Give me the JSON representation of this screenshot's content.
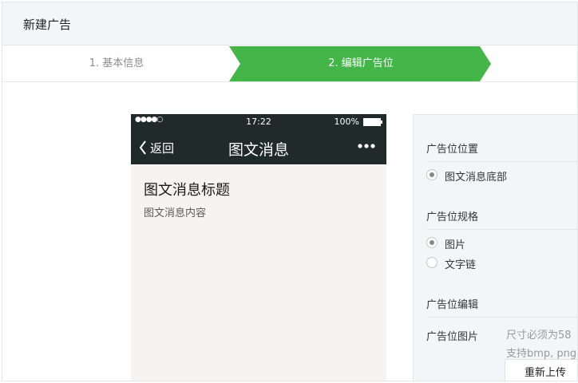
{
  "header": {
    "title": "新建广告"
  },
  "steps": [
    {
      "label": "1. 基本信息",
      "active": false
    },
    {
      "label": "2. 编辑广告位",
      "active": true
    }
  ],
  "colors": {
    "accent": "#44b549",
    "phone_dark": "#212a2b",
    "panel_bg": "#f4f5f9"
  },
  "phone": {
    "status": {
      "signal": "●●●●○",
      "time": "17:22",
      "battery": "100%"
    },
    "nav": {
      "back_label": "返回",
      "title": "图文消息",
      "more_icon": "more-dots-icon"
    },
    "article": {
      "title": "图文消息标题",
      "body": "图文消息内容"
    }
  },
  "panel": {
    "position": {
      "title": "广告位位置",
      "options": [
        {
          "label": "图文消息底部",
          "selected": true
        }
      ]
    },
    "spec": {
      "title": "广告位规格",
      "options": [
        {
          "label": "图片",
          "selected": true
        },
        {
          "label": "文字链",
          "selected": false
        }
      ]
    },
    "edit": {
      "title": "广告位编辑",
      "image_label": "广告位图片",
      "hint_line1": "尺寸必须为58",
      "hint_line2": "支持bmp, png",
      "reupload_label": "重新上传"
    }
  }
}
